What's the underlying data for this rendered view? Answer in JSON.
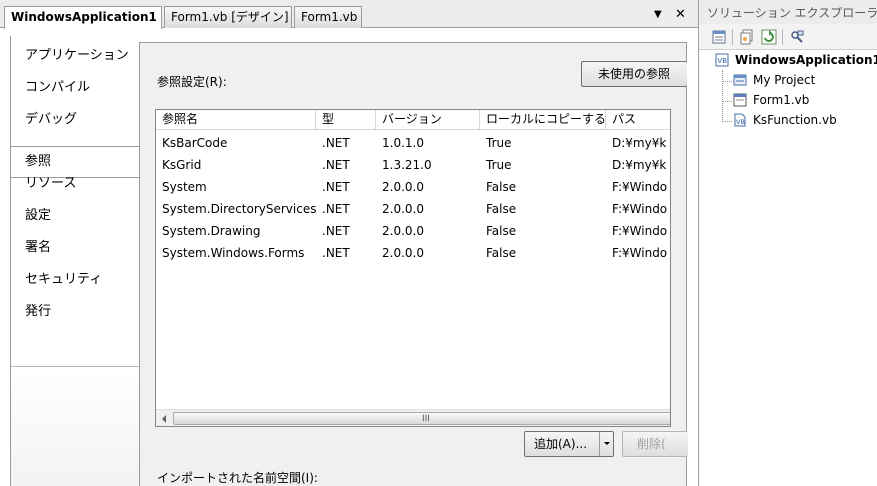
{
  "document_tabs": [
    {
      "label": "WindowsApplication1",
      "active": true
    },
    {
      "label": "Form1.vb [デザイン]",
      "active": false
    },
    {
      "label": "Form1.vb",
      "active": false
    }
  ],
  "tab_controls": {
    "dropdown": "▼",
    "close": "✕"
  },
  "nav_items": [
    "アプリケーション",
    "コンパイル",
    "デバッグ",
    "参照",
    "リソース",
    "設定",
    "署名",
    "セキュリティ",
    "発行"
  ],
  "nav_selected": "参照",
  "references": {
    "label": "参照設定(R):",
    "unused_button": "未使用の参照",
    "columns": [
      "参照名",
      "型",
      "バージョン",
      "ローカルにコピーする",
      "パス"
    ],
    "rows": [
      [
        "KsBarCode",
        ".NET",
        "1.0.1.0",
        "True",
        "D:¥my¥k"
      ],
      [
        "KsGrid",
        ".NET",
        "1.3.21.0",
        "True",
        "D:¥my¥k"
      ],
      [
        "System",
        ".NET",
        "2.0.0.0",
        "False",
        "F:¥Windo"
      ],
      [
        "System.DirectoryServices",
        ".NET",
        "2.0.0.0",
        "False",
        "F:¥Windo"
      ],
      [
        "System.Drawing",
        ".NET",
        "2.0.0.0",
        "False",
        "F:¥Windo"
      ],
      [
        "System.Windows.Forms",
        ".NET",
        "2.0.0.0",
        "False",
        "F:¥Windo"
      ]
    ],
    "scroll_grip": "III",
    "add_button": "追加(A)...",
    "remove_button": "削除("
  },
  "imports_label": "インポートされた名前空間(I):",
  "solution_explorer": {
    "title": "ソリューション エクスプローラ",
    "toolbar_icons": [
      "properties-icon",
      "show-all-files-icon",
      "refresh-icon",
      "class-view-icon"
    ],
    "project": "WindowsApplication1",
    "items": [
      {
        "label": "My Project",
        "icon": "my-project-icon"
      },
      {
        "label": "Form1.vb",
        "icon": "form-icon"
      },
      {
        "label": "KsFunction.vb",
        "icon": "vb-file-icon"
      }
    ]
  },
  "colors": {
    "accent_blue": "#2a6fc9",
    "panel_bg": "#f0f0f0",
    "border": "#9a9a9a"
  }
}
